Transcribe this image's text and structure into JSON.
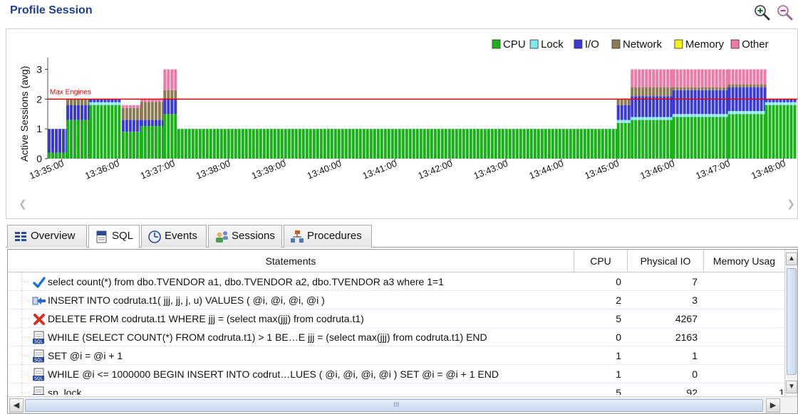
{
  "header": {
    "title": "Profile Session",
    "zoom_in_icon": "zoom-in-icon",
    "zoom_out_icon": "zoom-out-icon"
  },
  "chart_data": {
    "type": "bar",
    "stacked": true,
    "ylabel": "Active Sessions (avg)",
    "ylim": [
      0,
      3.3
    ],
    "yticks": [
      "0",
      "1",
      "2",
      "3"
    ],
    "threshold": {
      "label": "Max Engines",
      "value": 2,
      "color": "#e00000"
    },
    "legend_position": "top-right",
    "xticks": [
      "13:35:00",
      "13:36:00",
      "13:37:00",
      "13:38:00",
      "13:39:00",
      "13:40:00",
      "13:41:00",
      "13:42:00",
      "13:43:00",
      "13:44:00",
      "13:45:00",
      "13:46:00",
      "13:47:00",
      "13:48:00"
    ],
    "series": [
      {
        "name": "CPU",
        "color": "#19b319"
      },
      {
        "name": "Lock",
        "color": "#7fe8f0"
      },
      {
        "name": "I/O",
        "color": "#3a3ad8"
      },
      {
        "name": "Network",
        "color": "#8c7a55"
      },
      {
        "name": "Memory",
        "color": "#f2f21a"
      },
      {
        "name": "Other",
        "color": "#ee7aa8"
      }
    ],
    "segments": [
      {
        "start": "13:34:45",
        "end": "13:35:05",
        "cpu": 0.2,
        "lock": 0,
        "io": 0.8,
        "network": 0,
        "memory": 0,
        "other": 0
      },
      {
        "start": "13:35:05",
        "end": "13:35:30",
        "cpu": 1.3,
        "lock": 0,
        "io": 0.5,
        "network": 0.2,
        "memory": 0,
        "other": 0
      },
      {
        "start": "13:35:30",
        "end": "13:36:05",
        "cpu": 1.8,
        "lock": 0.1,
        "io": 0.1,
        "network": 0,
        "memory": 0,
        "other": 0
      },
      {
        "start": "13:36:05",
        "end": "13:36:25",
        "cpu": 0.9,
        "lock": 0,
        "io": 0.4,
        "network": 0.4,
        "memory": 0,
        "other": 0.1
      },
      {
        "start": "13:36:25",
        "end": "13:36:50",
        "cpu": 1.1,
        "lock": 0,
        "io": 0.2,
        "network": 0.6,
        "memory": 0,
        "other": 0.1
      },
      {
        "start": "13:36:50",
        "end": "13:37:05",
        "cpu": 1.5,
        "lock": 0,
        "io": 0.5,
        "network": 0.3,
        "memory": 0,
        "other": 0.7
      },
      {
        "start": "13:37:05",
        "end": "13:45:00",
        "cpu": 1.0,
        "lock": 0,
        "io": 0,
        "network": 0,
        "memory": 0,
        "other": 0
      },
      {
        "start": "13:45:00",
        "end": "13:45:15",
        "cpu": 1.2,
        "lock": 0.1,
        "io": 0.5,
        "network": 0.2,
        "memory": 0,
        "other": 0
      },
      {
        "start": "13:45:15",
        "end": "13:46:00",
        "cpu": 1.3,
        "lock": 0.1,
        "io": 0.7,
        "network": 0.3,
        "memory": 0,
        "other": 0.6
      },
      {
        "start": "13:46:00",
        "end": "13:47:00",
        "cpu": 1.4,
        "lock": 0.1,
        "io": 0.8,
        "network": 0.1,
        "memory": 0,
        "other": 0.6
      },
      {
        "start": "13:47:00",
        "end": "13:47:40",
        "cpu": 1.5,
        "lock": 0.1,
        "io": 0.8,
        "network": 0.1,
        "memory": 0,
        "other": 0.5
      },
      {
        "start": "13:47:40",
        "end": "13:48:15",
        "cpu": 1.8,
        "lock": 0.1,
        "io": 0.1,
        "network": 0,
        "memory": 0,
        "other": 0
      }
    ]
  },
  "tabs": [
    {
      "label": "Overview",
      "icon": "overview-icon",
      "active": false
    },
    {
      "label": "SQL",
      "icon": "sql-icon",
      "active": true
    },
    {
      "label": "Events",
      "icon": "events-icon",
      "active": false
    },
    {
      "label": "Sessions",
      "icon": "sessions-icon",
      "active": false
    },
    {
      "label": "Procedures",
      "icon": "procedures-icon",
      "active": false
    }
  ],
  "table": {
    "columns": [
      "Statements",
      "CPU",
      "Physical IO",
      "Memory Usag"
    ],
    "rows": [
      {
        "icon": "check-icon",
        "statement": "select count(*) from dbo.TVENDOR a1, dbo.TVENDOR a2, dbo.TVENDOR a3 where 1=1",
        "cpu": "0",
        "physical_io": "7",
        "memory": ""
      },
      {
        "icon": "insert-icon",
        "statement": "INSERT INTO codruta.t1( jjj, jj, j, u) VALUES ( @i, @i, @i, @i )",
        "cpu": "2",
        "physical_io": "3",
        "memory": ""
      },
      {
        "icon": "delete-icon",
        "statement": "DELETE FROM codruta.t1 WHERE jjj = (select max(jjj) from codruta.t1)",
        "cpu": "5",
        "physical_io": "4267",
        "memory": ""
      },
      {
        "icon": "sql-file-icon",
        "statement": "WHILE (SELECT COUNT(*) FROM codruta.t1) > 1 BE…E jjj = (select max(jjj) from codruta.t1) END",
        "cpu": "0",
        "physical_io": "2163",
        "memory": ""
      },
      {
        "icon": "sql-file-icon",
        "statement": "SET @i = @i + 1",
        "cpu": "1",
        "physical_io": "1",
        "memory": ""
      },
      {
        "icon": "sql-file-icon",
        "statement": "WHILE @i <= 1000000 BEGIN INSERT INTO codrut…LUES ( @i, @i, @i, @i ) SET @i = @i + 1 END",
        "cpu": "1",
        "physical_io": "0",
        "memory": ""
      },
      {
        "icon": "sql-file-icon",
        "statement": "sp_lock",
        "cpu": "5",
        "physical_io": "92",
        "memory": "1"
      }
    ]
  },
  "scrollbar": {
    "grip": "III"
  }
}
